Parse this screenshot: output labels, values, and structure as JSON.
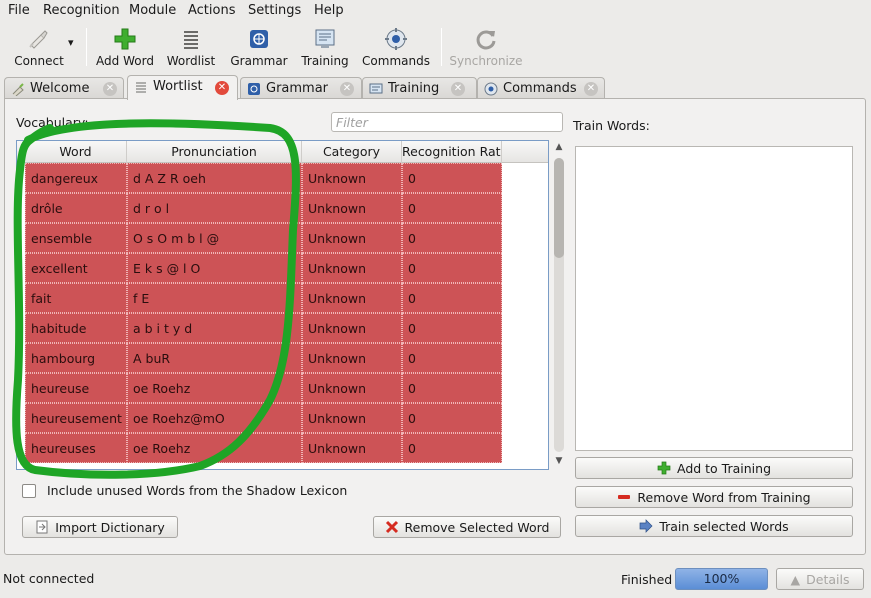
{
  "menu": [
    "File",
    "Recognition",
    "Module",
    "Actions",
    "Settings",
    "Help"
  ],
  "toolbar": {
    "connect": "Connect",
    "add_word": "Add Word",
    "wordlist": "Wordlist",
    "grammar": "Grammar",
    "training": "Training",
    "commands": "Commands",
    "synchronize": "Synchronize"
  },
  "tabs": [
    {
      "label": "Welcome",
      "active": false
    },
    {
      "label": "Wortlist",
      "active": true
    },
    {
      "label": "Grammar",
      "active": false
    },
    {
      "label": "Training",
      "active": false
    },
    {
      "label": "Commands",
      "active": false
    }
  ],
  "vocabulary": {
    "label": "Vocabulary:",
    "filter_placeholder": "Filter",
    "columns": [
      "Word",
      "Pronunciation",
      "Category",
      "Recognition Rate"
    ],
    "rows": [
      [
        "dangereux",
        "d A Z R oeh",
        "Unknown",
        "0"
      ],
      [
        "drôle",
        "d r o l",
        "Unknown",
        "0"
      ],
      [
        "ensemble",
        "O s O m b l @",
        "Unknown",
        "0"
      ],
      [
        "excellent",
        "E k s @ l O",
        "Unknown",
        "0"
      ],
      [
        "fait",
        "f E",
        "Unknown",
        "0"
      ],
      [
        "habitude",
        "a b i t y d",
        "Unknown",
        "0"
      ],
      [
        "hambourg",
        "A buR",
        "Unknown",
        "0"
      ],
      [
        "heureuse",
        "oe Roehz",
        "Unknown",
        "0"
      ],
      [
        "heureusement",
        "oe Roehz@mO",
        "Unknown",
        "0"
      ],
      [
        "heureuses",
        "oe Roehz",
        "Unknown",
        "0"
      ]
    ],
    "include_unused_label": "Include unused Words from the Shadow Lexicon",
    "import_button": "Import Dictionary",
    "remove_button": "Remove Selected Word"
  },
  "training": {
    "label": "Train Words:",
    "add_button": "Add to Training",
    "remove_button": "Remove Word from Training",
    "train_button": "Train selected Words"
  },
  "status": {
    "connection": "Not connected",
    "finished_label": "Finished",
    "progress": "100%",
    "details": "Details"
  },
  "colors": {
    "row_highlight": "#cd5356",
    "annotation": "#1fa526"
  }
}
